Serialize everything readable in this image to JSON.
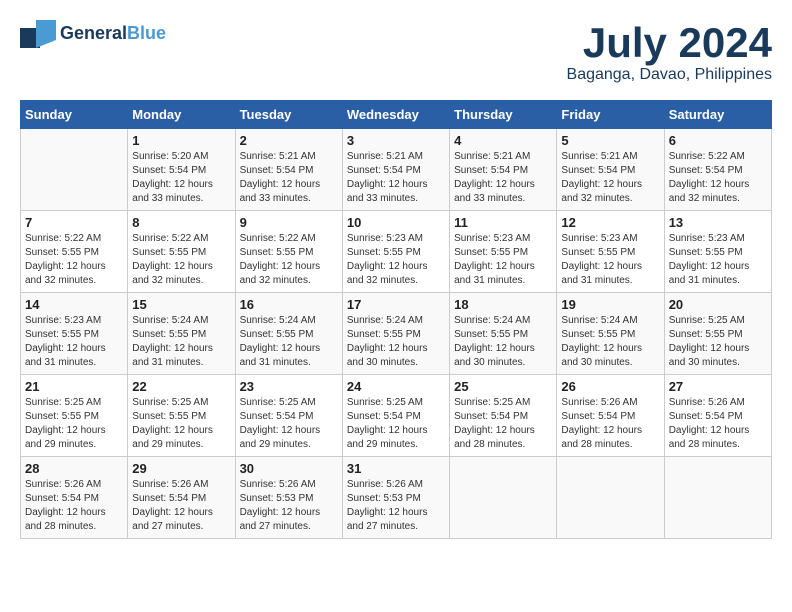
{
  "header": {
    "logo_general": "General",
    "logo_blue": "Blue",
    "month_year": "July 2024",
    "location": "Baganga, Davao, Philippines"
  },
  "columns": [
    "Sunday",
    "Monday",
    "Tuesday",
    "Wednesday",
    "Thursday",
    "Friday",
    "Saturday"
  ],
  "weeks": [
    {
      "days": [
        {
          "num": "",
          "info": ""
        },
        {
          "num": "1",
          "info": "Sunrise: 5:20 AM\nSunset: 5:54 PM\nDaylight: 12 hours\nand 33 minutes."
        },
        {
          "num": "2",
          "info": "Sunrise: 5:21 AM\nSunset: 5:54 PM\nDaylight: 12 hours\nand 33 minutes."
        },
        {
          "num": "3",
          "info": "Sunrise: 5:21 AM\nSunset: 5:54 PM\nDaylight: 12 hours\nand 33 minutes."
        },
        {
          "num": "4",
          "info": "Sunrise: 5:21 AM\nSunset: 5:54 PM\nDaylight: 12 hours\nand 33 minutes."
        },
        {
          "num": "5",
          "info": "Sunrise: 5:21 AM\nSunset: 5:54 PM\nDaylight: 12 hours\nand 32 minutes."
        },
        {
          "num": "6",
          "info": "Sunrise: 5:22 AM\nSunset: 5:54 PM\nDaylight: 12 hours\nand 32 minutes."
        }
      ]
    },
    {
      "days": [
        {
          "num": "7",
          "info": "Sunrise: 5:22 AM\nSunset: 5:55 PM\nDaylight: 12 hours\nand 32 minutes."
        },
        {
          "num": "8",
          "info": "Sunrise: 5:22 AM\nSunset: 5:55 PM\nDaylight: 12 hours\nand 32 minutes."
        },
        {
          "num": "9",
          "info": "Sunrise: 5:22 AM\nSunset: 5:55 PM\nDaylight: 12 hours\nand 32 minutes."
        },
        {
          "num": "10",
          "info": "Sunrise: 5:23 AM\nSunset: 5:55 PM\nDaylight: 12 hours\nand 32 minutes."
        },
        {
          "num": "11",
          "info": "Sunrise: 5:23 AM\nSunset: 5:55 PM\nDaylight: 12 hours\nand 31 minutes."
        },
        {
          "num": "12",
          "info": "Sunrise: 5:23 AM\nSunset: 5:55 PM\nDaylight: 12 hours\nand 31 minutes."
        },
        {
          "num": "13",
          "info": "Sunrise: 5:23 AM\nSunset: 5:55 PM\nDaylight: 12 hours\nand 31 minutes."
        }
      ]
    },
    {
      "days": [
        {
          "num": "14",
          "info": "Sunrise: 5:23 AM\nSunset: 5:55 PM\nDaylight: 12 hours\nand 31 minutes."
        },
        {
          "num": "15",
          "info": "Sunrise: 5:24 AM\nSunset: 5:55 PM\nDaylight: 12 hours\nand 31 minutes."
        },
        {
          "num": "16",
          "info": "Sunrise: 5:24 AM\nSunset: 5:55 PM\nDaylight: 12 hours\nand 31 minutes."
        },
        {
          "num": "17",
          "info": "Sunrise: 5:24 AM\nSunset: 5:55 PM\nDaylight: 12 hours\nand 30 minutes."
        },
        {
          "num": "18",
          "info": "Sunrise: 5:24 AM\nSunset: 5:55 PM\nDaylight: 12 hours\nand 30 minutes."
        },
        {
          "num": "19",
          "info": "Sunrise: 5:24 AM\nSunset: 5:55 PM\nDaylight: 12 hours\nand 30 minutes."
        },
        {
          "num": "20",
          "info": "Sunrise: 5:25 AM\nSunset: 5:55 PM\nDaylight: 12 hours\nand 30 minutes."
        }
      ]
    },
    {
      "days": [
        {
          "num": "21",
          "info": "Sunrise: 5:25 AM\nSunset: 5:55 PM\nDaylight: 12 hours\nand 29 minutes."
        },
        {
          "num": "22",
          "info": "Sunrise: 5:25 AM\nSunset: 5:55 PM\nDaylight: 12 hours\nand 29 minutes."
        },
        {
          "num": "23",
          "info": "Sunrise: 5:25 AM\nSunset: 5:54 PM\nDaylight: 12 hours\nand 29 minutes."
        },
        {
          "num": "24",
          "info": "Sunrise: 5:25 AM\nSunset: 5:54 PM\nDaylight: 12 hours\nand 29 minutes."
        },
        {
          "num": "25",
          "info": "Sunrise: 5:25 AM\nSunset: 5:54 PM\nDaylight: 12 hours\nand 28 minutes."
        },
        {
          "num": "26",
          "info": "Sunrise: 5:26 AM\nSunset: 5:54 PM\nDaylight: 12 hours\nand 28 minutes."
        },
        {
          "num": "27",
          "info": "Sunrise: 5:26 AM\nSunset: 5:54 PM\nDaylight: 12 hours\nand 28 minutes."
        }
      ]
    },
    {
      "days": [
        {
          "num": "28",
          "info": "Sunrise: 5:26 AM\nSunset: 5:54 PM\nDaylight: 12 hours\nand 28 minutes."
        },
        {
          "num": "29",
          "info": "Sunrise: 5:26 AM\nSunset: 5:54 PM\nDaylight: 12 hours\nand 27 minutes."
        },
        {
          "num": "30",
          "info": "Sunrise: 5:26 AM\nSunset: 5:53 PM\nDaylight: 12 hours\nand 27 minutes."
        },
        {
          "num": "31",
          "info": "Sunrise: 5:26 AM\nSunset: 5:53 PM\nDaylight: 12 hours\nand 27 minutes."
        },
        {
          "num": "",
          "info": ""
        },
        {
          "num": "",
          "info": ""
        },
        {
          "num": "",
          "info": ""
        }
      ]
    }
  ]
}
